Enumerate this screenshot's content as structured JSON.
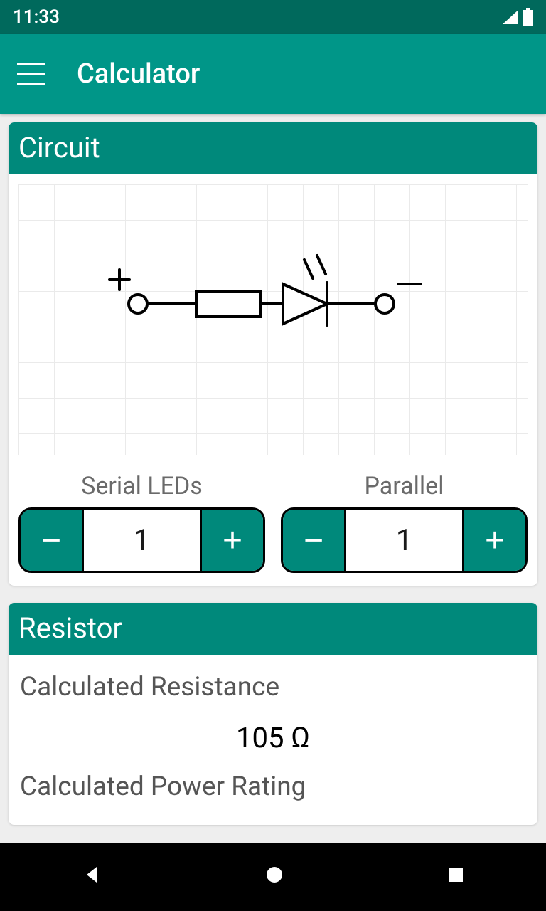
{
  "status": {
    "time": "11:33"
  },
  "appbar": {
    "title": "Calculator"
  },
  "circuit": {
    "header": "Circuit",
    "serial_label": "Serial LEDs",
    "parallel_label": "Parallel",
    "serial_value": "1",
    "parallel_value": "1",
    "minus": "−",
    "plus": "+"
  },
  "resistor": {
    "header": "Resistor",
    "calc_resistance_label": "Calculated Resistance",
    "calc_resistance_value": "105 Ω",
    "calc_power_label": "Calculated Power Rating"
  }
}
